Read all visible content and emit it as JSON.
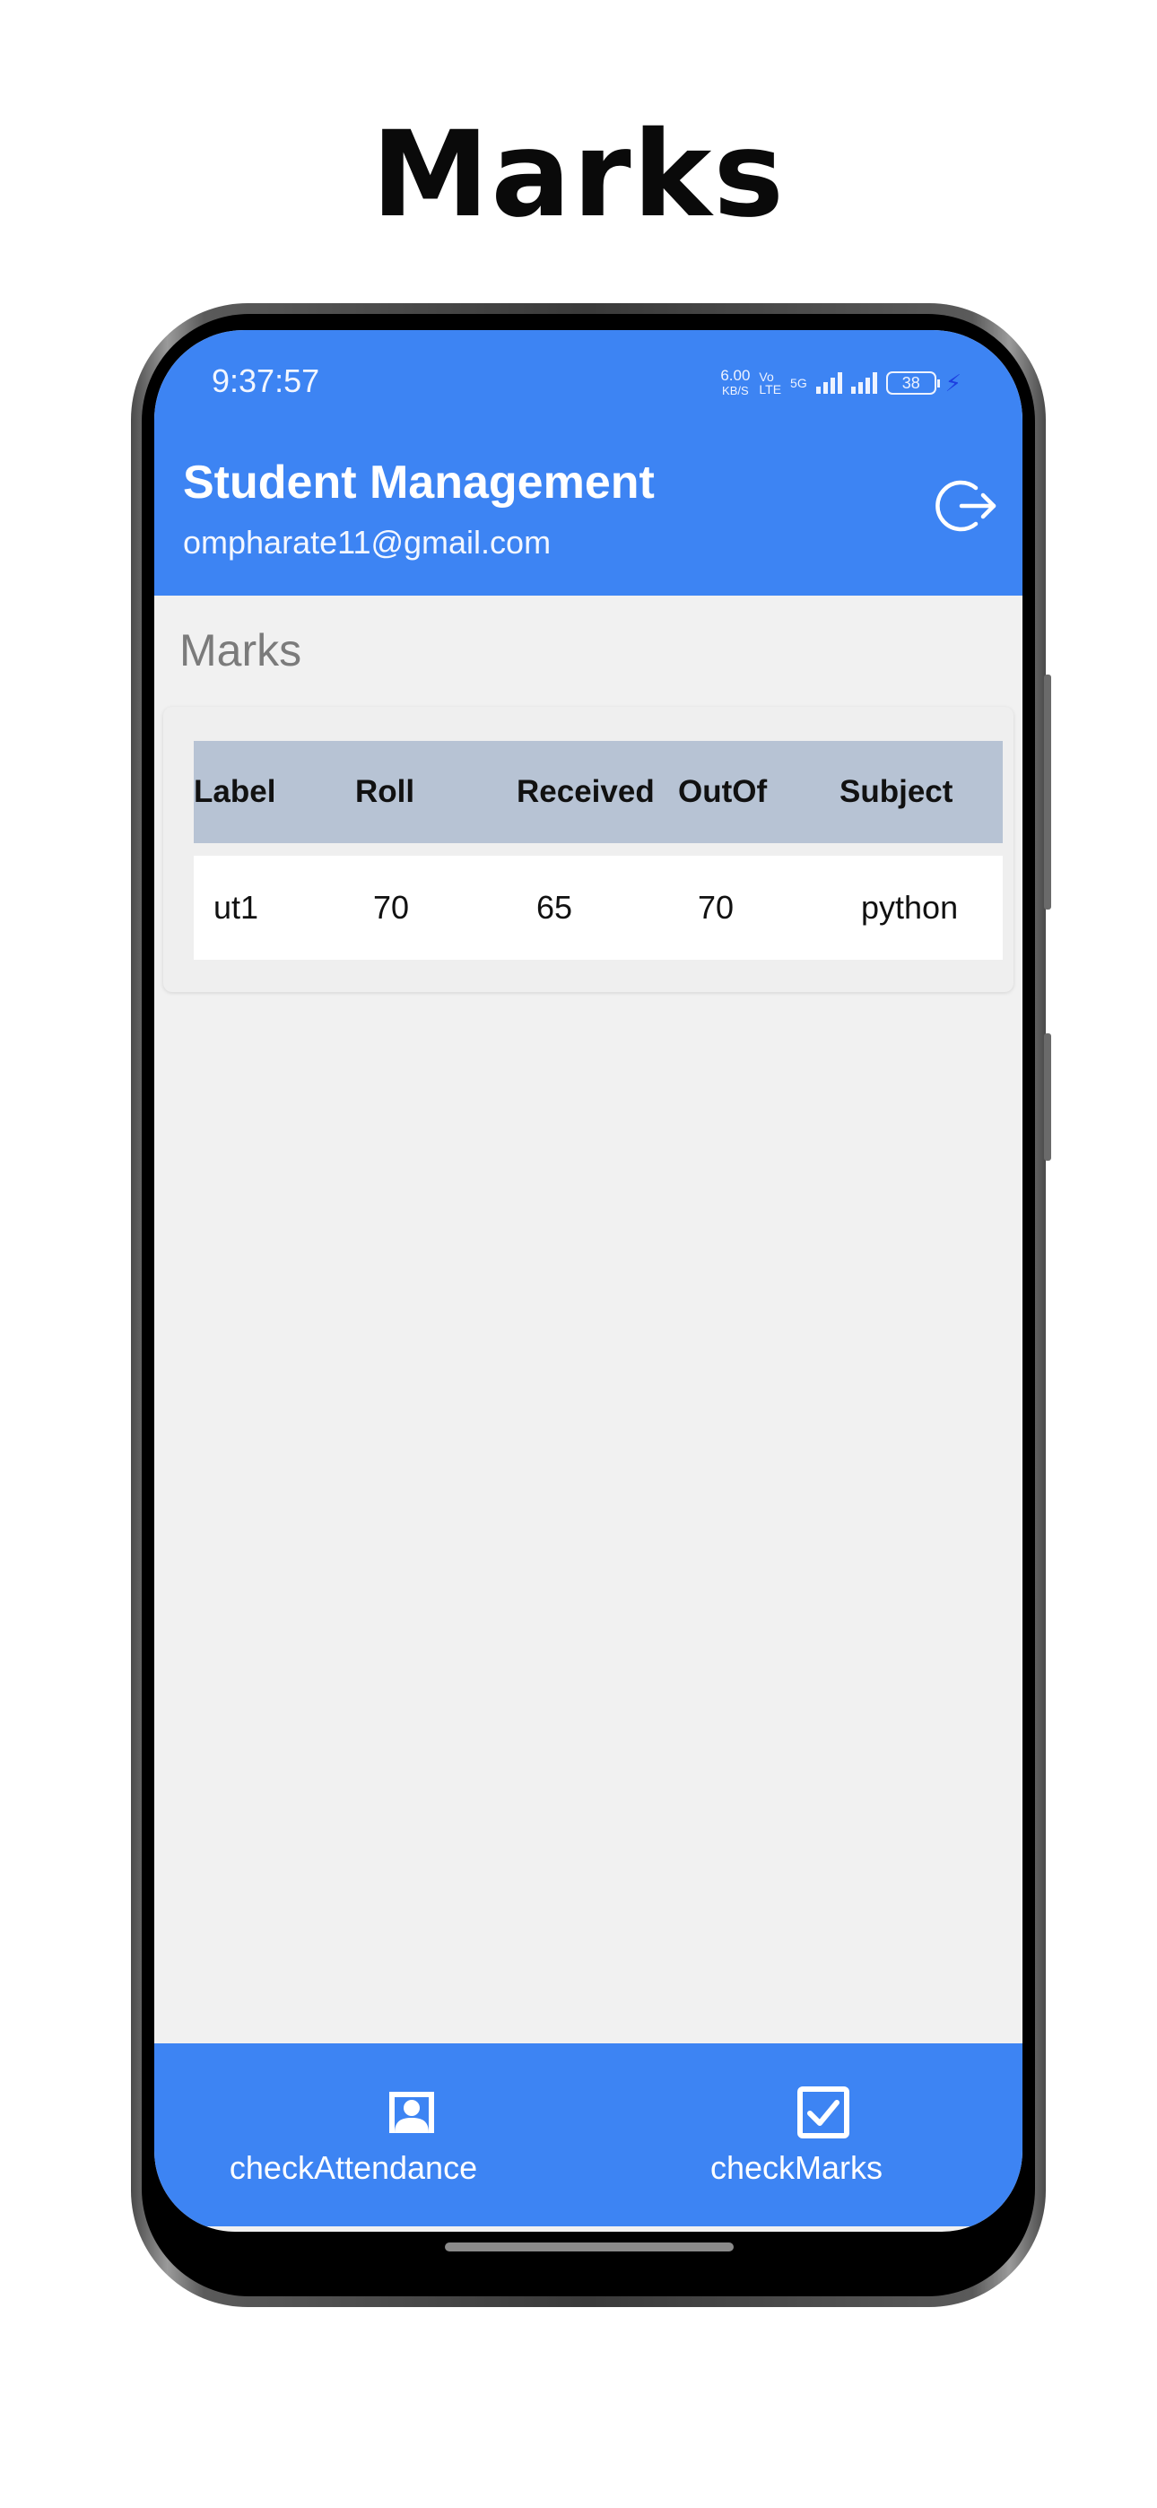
{
  "page_heading": "Marks",
  "status_bar": {
    "time": "9:37:57",
    "net_speed_value": "6.00",
    "net_speed_unit": "KB/S",
    "volte_1": "Vo",
    "volte_2": "LTE",
    "network": "5G",
    "battery": "38"
  },
  "header": {
    "title": "Student Management",
    "email": "ompharate11@gmail.com"
  },
  "section_title": "Marks",
  "table": {
    "columns": [
      "Label",
      "Roll",
      "Received",
      "OutOf",
      "Subject"
    ],
    "rows": [
      [
        "ut1",
        "70",
        "65",
        "70",
        "python"
      ]
    ]
  },
  "bottom_nav": {
    "items": [
      {
        "label": "checkAttendance",
        "icon": "attendance-person-icon"
      },
      {
        "label": "checkMarks",
        "icon": "checkbox-icon"
      }
    ]
  },
  "colors": {
    "primary": "#3d84f3",
    "table_header": "#b7c3d4",
    "background": "#f1f1f1"
  }
}
